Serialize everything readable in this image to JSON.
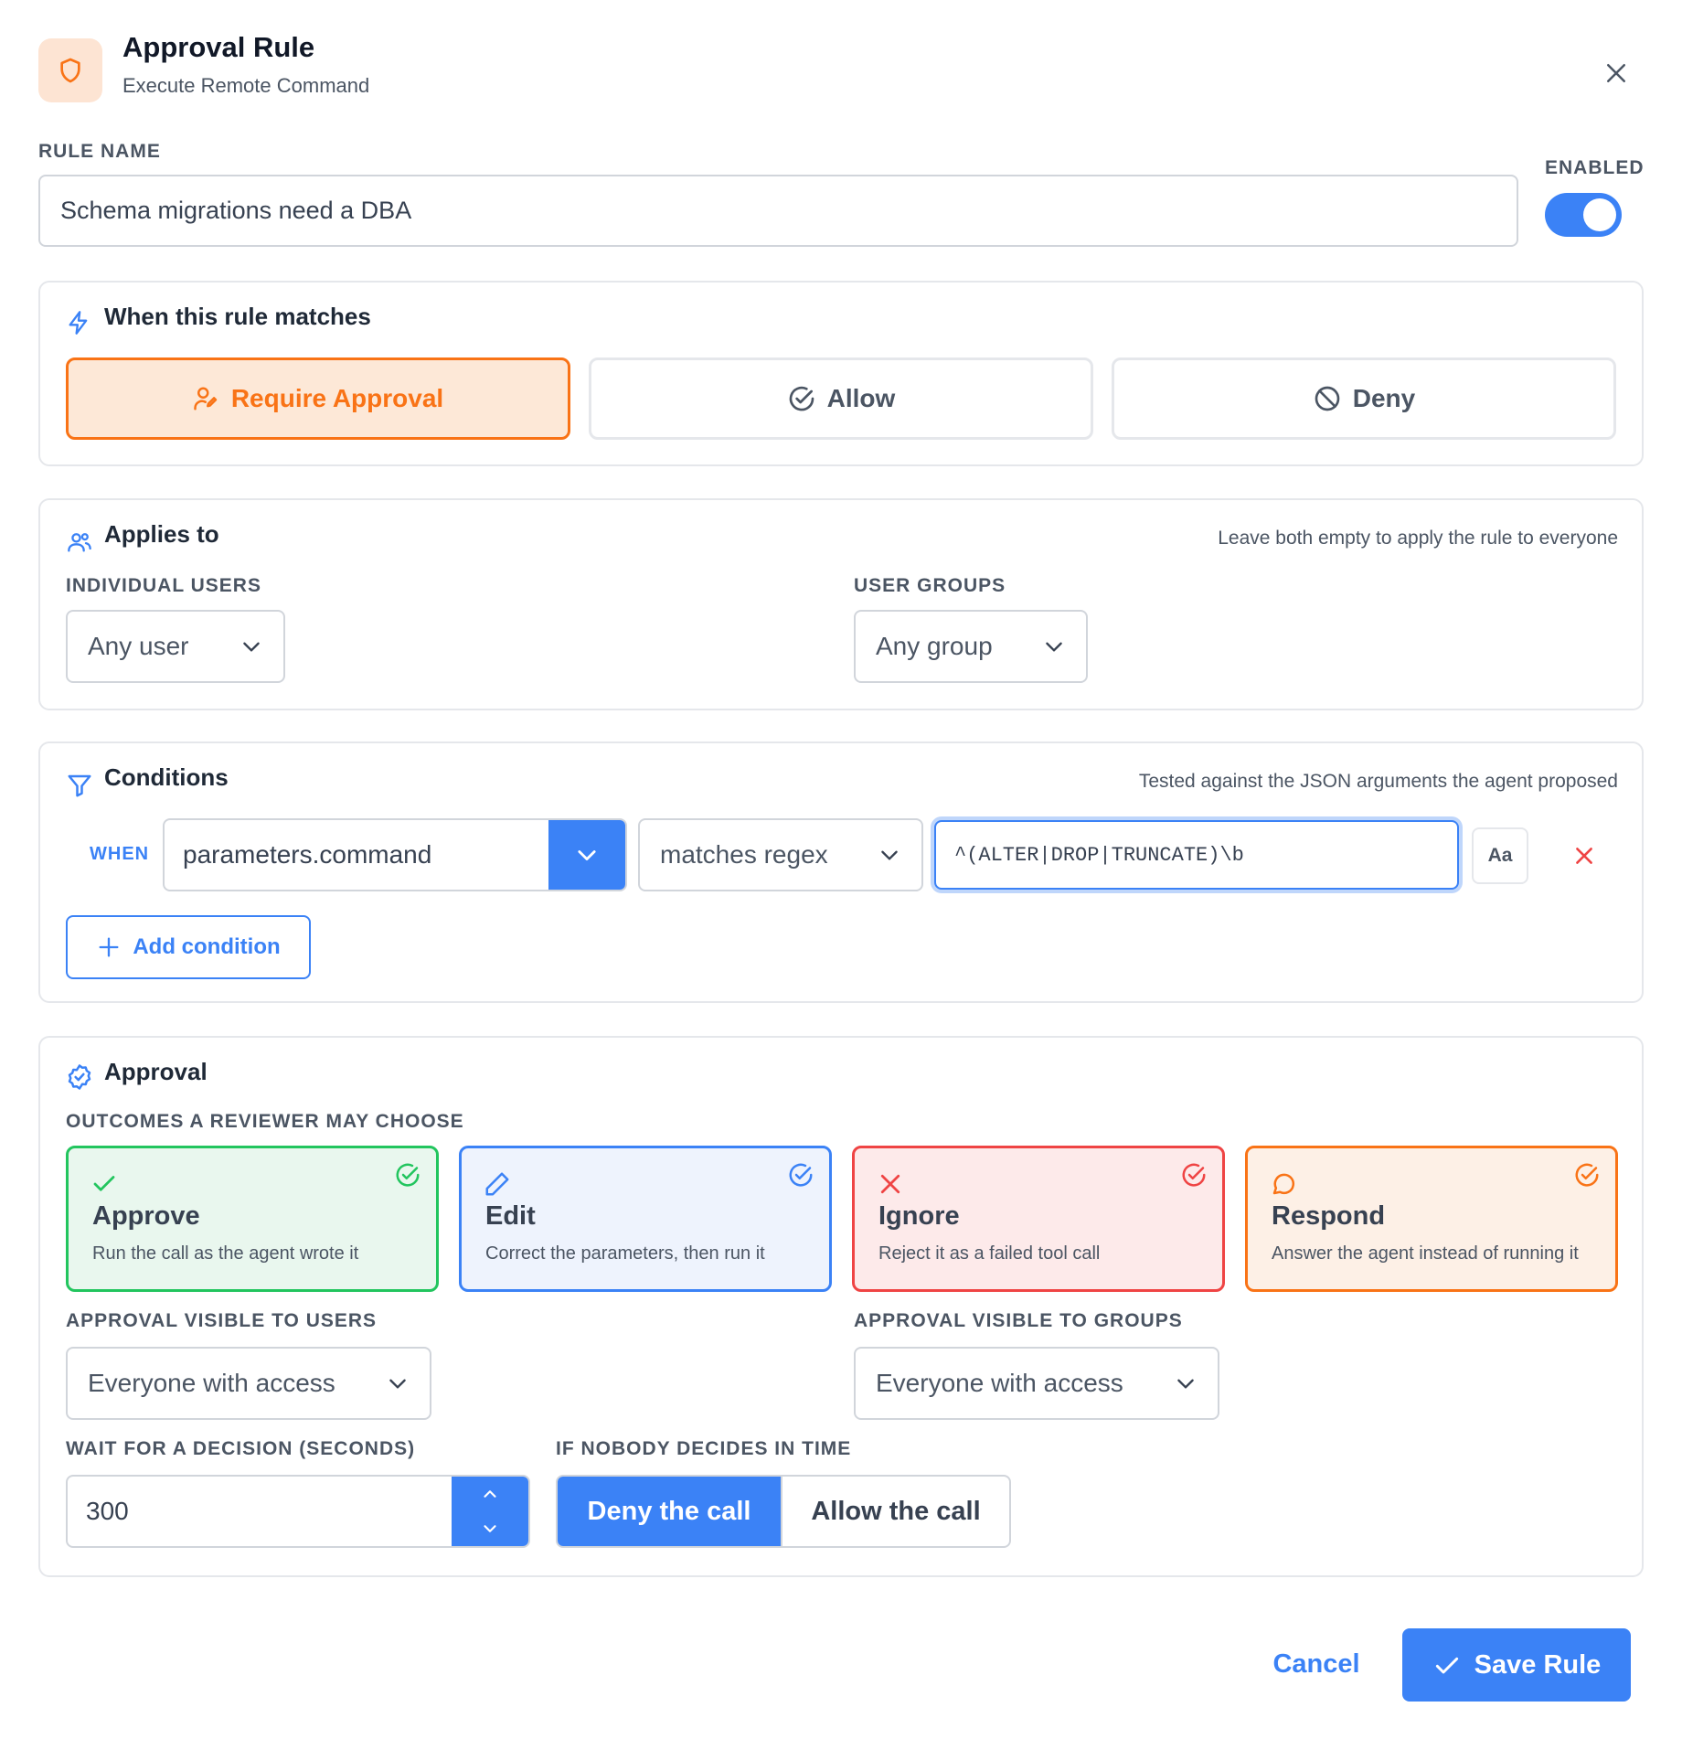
{
  "header": {
    "title": "Approval Rule",
    "subtitle": "Execute Remote Command",
    "icon": "shield-icon",
    "close_icon": "close-icon"
  },
  "rule_name": {
    "label": "RULE NAME",
    "value": "Schema migrations need a DBA"
  },
  "enabled": {
    "label": "ENABLED",
    "on": true
  },
  "match": {
    "title": "When this rule matches",
    "options": [
      {
        "label": "Require Approval",
        "icon": "user-pen-icon",
        "active": true
      },
      {
        "label": "Allow",
        "icon": "check-circle-icon",
        "active": false
      },
      {
        "label": "Deny",
        "icon": "ban-icon",
        "active": false
      }
    ]
  },
  "applies": {
    "title": "Applies to",
    "note": "Leave both empty to apply the rule to everyone",
    "users_label": "INDIVIDUAL USERS",
    "users_value": "Any user",
    "groups_label": "USER GROUPS",
    "groups_value": "Any group"
  },
  "conditions": {
    "title": "Conditions",
    "note": "Tested against the JSON arguments the agent proposed",
    "when_label": "WHEN",
    "field": "parameters.command",
    "operator": "matches regex",
    "value": "^(ALTER|DROP|TRUNCATE)\\b",
    "case_toggle": "Aa",
    "add_label": "Add condition"
  },
  "approval": {
    "title": "Approval",
    "outcomes_label": "OUTCOMES A REVIEWER MAY CHOOSE",
    "outcomes": [
      {
        "title": "Approve",
        "desc": "Run the call as the agent wrote it",
        "color": "#22c55e",
        "bg": "#e9f7ee",
        "icon": "check-icon"
      },
      {
        "title": "Edit",
        "desc": "Correct the parameters, then run it",
        "color": "#3b82f6",
        "bg": "#eef3fd",
        "icon": "pencil-icon"
      },
      {
        "title": "Ignore",
        "desc": "Reject it as a failed tool call",
        "color": "#ef4444",
        "bg": "#fdeaea",
        "icon": "x-icon"
      },
      {
        "title": "Respond",
        "desc": "Answer the agent instead of running it",
        "color": "#f97316",
        "bg": "#fdf0e6",
        "icon": "message-circle-icon"
      }
    ],
    "visible_users_label": "APPROVAL VISIBLE TO USERS",
    "visible_users_value": "Everyone with access",
    "visible_groups_label": "APPROVAL VISIBLE TO GROUPS",
    "visible_groups_value": "Everyone with access",
    "wait_label": "WAIT FOR A DECISION (SECONDS)",
    "wait_value": "300",
    "timeout_label": "IF NOBODY DECIDES IN TIME",
    "timeout_options": [
      {
        "label": "Deny the call",
        "active": true
      },
      {
        "label": "Allow the call",
        "active": false
      }
    ]
  },
  "footer": {
    "cancel_label": "Cancel",
    "save_label": "Save Rule"
  },
  "colors": {
    "accent": "#3b82f6",
    "warn": "#f97316",
    "danger": "#ef4444",
    "success": "#22c55e"
  }
}
